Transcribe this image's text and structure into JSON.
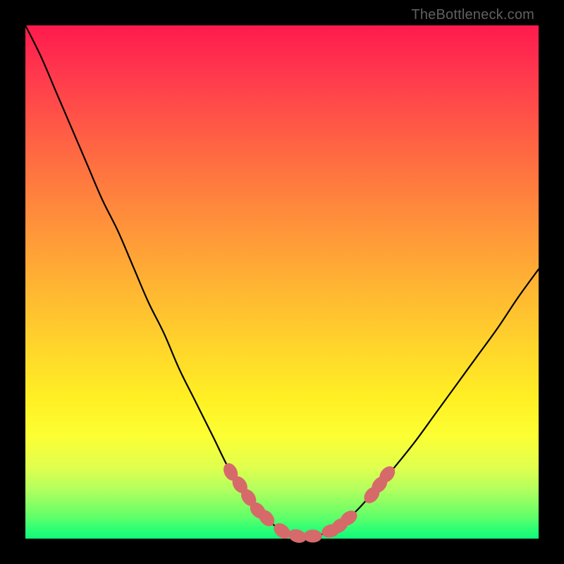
{
  "watermark_text": "TheBottleneck.com",
  "colors": {
    "frame_bg": "#000000",
    "curve_stroke": "#000000",
    "marker_fill": "#d66a6a",
    "gradient_top": "#ff1a4d",
    "gradient_bottom": "#10f97a"
  },
  "chart_data": {
    "type": "line",
    "title": "",
    "xlabel": "",
    "ylabel": "",
    "xlim": [
      0,
      100
    ],
    "ylim": [
      0,
      100
    ],
    "grid": false,
    "series": [
      {
        "name": "bottleneck-curve",
        "x": [
          0,
          3,
          6,
          9,
          12,
          15,
          18,
          21,
          24,
          27,
          30,
          33,
          36.5,
          40,
          43.5,
          47,
          50,
          53,
          56,
          59.5,
          63,
          66,
          69,
          72,
          76,
          80,
          84,
          88,
          92,
          96,
          100
        ],
        "values": [
          100,
          94,
          87,
          80,
          73,
          66,
          60,
          53,
          46,
          40,
          33,
          27,
          20,
          13,
          8,
          4,
          1.5,
          0.5,
          0.5,
          1.5,
          4,
          7,
          10.5,
          14,
          19,
          24.5,
          30,
          35.5,
          41,
          47,
          52.5
        ]
      }
    ],
    "markers": [
      {
        "x": 40.0,
        "y": 13.0
      },
      {
        "x": 41.8,
        "y": 10.5
      },
      {
        "x": 43.5,
        "y": 8.0
      },
      {
        "x": 45.3,
        "y": 5.5
      },
      {
        "x": 47.0,
        "y": 4.0
      },
      {
        "x": 50.0,
        "y": 1.5
      },
      {
        "x": 53.0,
        "y": 0.5
      },
      {
        "x": 56.0,
        "y": 0.5
      },
      {
        "x": 59.5,
        "y": 1.5
      },
      {
        "x": 61.2,
        "y": 2.5
      },
      {
        "x": 63.0,
        "y": 4.0
      },
      {
        "x": 67.5,
        "y": 8.5
      },
      {
        "x": 69.0,
        "y": 10.5
      },
      {
        "x": 70.5,
        "y": 12.5
      }
    ],
    "marker_radius_data_units": 1.2
  }
}
